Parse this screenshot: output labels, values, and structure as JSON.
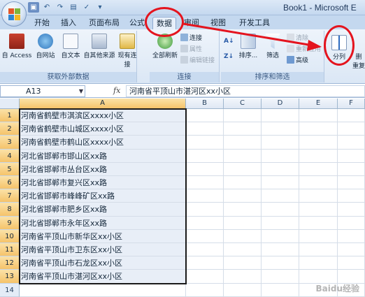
{
  "window": {
    "title": "Book1 - Microsoft E"
  },
  "tabs": [
    {
      "key": "home",
      "label": "开始"
    },
    {
      "key": "insert",
      "label": "插入"
    },
    {
      "key": "layout",
      "label": "页面布局"
    },
    {
      "key": "formulas",
      "label": "公式"
    },
    {
      "key": "data",
      "label": "数据",
      "active": true
    },
    {
      "key": "review",
      "label": "审阅"
    },
    {
      "key": "view",
      "label": "视图"
    },
    {
      "key": "developer",
      "label": "开发工具"
    }
  ],
  "ribbon": {
    "groups": {
      "external": "获取外部数据",
      "connections": "连接",
      "sortfilter": "排序和筛选"
    },
    "buttons": {
      "access": "自 Access",
      "web": "自网站",
      "text": "自文本",
      "other": "自其他来源",
      "existing": "现有连接",
      "refresh_all": "全部刷新",
      "connections": "连接",
      "properties": "属性",
      "edit_links": "编辑链接",
      "sort": "排序...",
      "filter": "筛选",
      "clear": "清除",
      "reapply": "重新应用",
      "advanced": "高级",
      "split": "分列",
      "remove_dup_partial": "删",
      "reapply_partial": "重复"
    }
  },
  "formula_bar": {
    "name_box": "A13",
    "fx": "fx",
    "value": "河南省平顶山市湛河区xx小区"
  },
  "grid": {
    "columns": [
      "A",
      "B",
      "C",
      "D",
      "E",
      "F"
    ],
    "rows": [
      "1",
      "2",
      "3",
      "4",
      "5",
      "6",
      "7",
      "8",
      "9",
      "10",
      "11",
      "12",
      "13",
      "14"
    ],
    "cells_a": [
      "河南省鹤壁市淇滨区xxxx小区",
      "河南省鹤壁市山城区xxxx小区",
      "河南省鹤壁市鹤山区xxxx小区",
      "河北省邯郸市邯山区xx路",
      "河北省邯郸市丛台区xx路",
      "河北省邯郸市复兴区xx路",
      "河北省邯郸市峰峰矿区xx路",
      "河北省邯郸市肥乡区xx路",
      "河北省邯郸市永年区xx路",
      "河南省平顶山市新华区xx小区",
      "河南省平顶山市卫东区xx小区",
      "河南省平顶山市石龙区xx小区",
      "河南省平顶山市湛河区xx小区"
    ]
  },
  "colors": {
    "annotation": "#e4141e",
    "selection_header": "#f5c36a",
    "ribbon": "#dbe7f5"
  },
  "icons": {
    "office": "office-logo-icon",
    "save": "save-icon",
    "undo": "undo-icon",
    "redo": "redo-icon",
    "access": "database-icon",
    "web": "globe-icon",
    "text": "text-file-icon",
    "other": "other-sources-icon",
    "existing": "existing-connections-icon",
    "refresh": "refresh-icon",
    "sort": "sort-icon",
    "filter": "filter-icon",
    "split": "text-to-columns-icon"
  },
  "watermark": "Baidu经验"
}
